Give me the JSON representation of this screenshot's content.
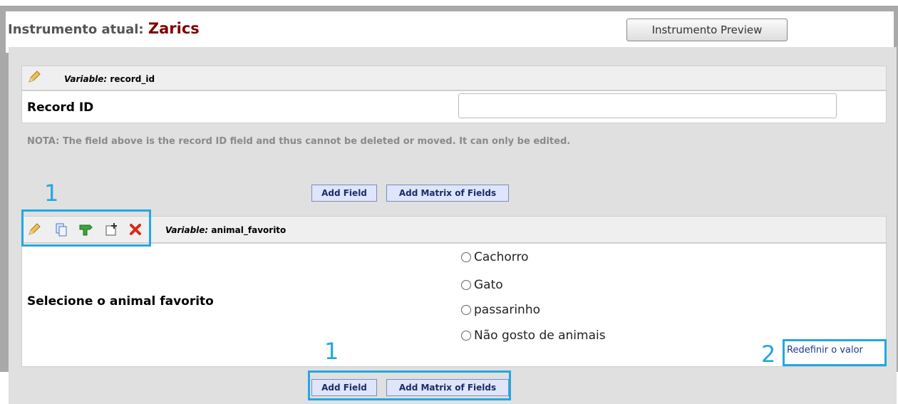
{
  "header": {
    "title_label": "Instrumento atual: ",
    "title_name": "Zarics",
    "preview_button": "Instrumento Preview"
  },
  "field1": {
    "variable_label": "Variable:",
    "variable_name": "record_id",
    "label": "Record ID",
    "value": ""
  },
  "nota": "NOTA: The field above is the record ID field and thus cannot be deleted or moved. It can only be edited.",
  "buttons": {
    "add_field": "Add Field",
    "add_matrix": "Add Matrix of Fields"
  },
  "field2": {
    "variable_label": "Variable:",
    "variable_name": "animal_favorito",
    "label": "Selecione o animal favorito",
    "options": [
      "Cachorro",
      "Gato",
      "passarinho",
      "Não gosto de animais"
    ],
    "reset_link": "Redefinir o valor"
  },
  "annotations": {
    "top_icons": "1",
    "bottom_buttons": "1",
    "reset": "2"
  },
  "icons": [
    "pencil-icon",
    "copy-icon",
    "branching-icon",
    "move-icon",
    "delete-icon"
  ]
}
